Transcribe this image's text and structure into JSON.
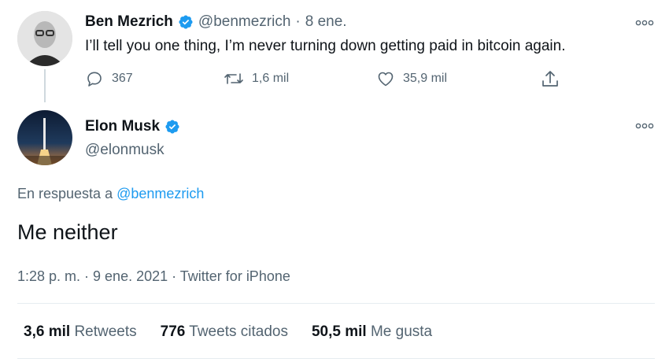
{
  "parent_tweet": {
    "author_name": "Ben Mezrich",
    "handle": "@benmezrich",
    "separator": "·",
    "date": "8 ene.",
    "text": "I’ll tell you one thing, I’m never turning down getting paid in bitcoin again.",
    "replies": "367",
    "retweets": "1,6 mil",
    "likes": "35,9 mil"
  },
  "main_tweet": {
    "author_name": "Elon Musk",
    "handle": "@elonmusk",
    "reply_prefix": "En respuesta a",
    "reply_to": "@benmezrich",
    "text": "Me neither",
    "timestamp": "1:28 p. m. · 9 ene. 2021 · Twitter for iPhone"
  },
  "stats": {
    "retweets_count": "3,6 mil",
    "retweets_label": "Retweets",
    "quotes_count": "776",
    "quotes_label": "Tweets citados",
    "likes_count": "50,5 mil",
    "likes_label": "Me gusta"
  },
  "colors": {
    "accent": "#1d9bf0",
    "text": "#0f1419",
    "muted": "#536471",
    "divider": "#e6ecf0"
  },
  "icons": [
    "verified-badge-icon",
    "more-options-icon",
    "reply-icon",
    "retweet-icon",
    "like-icon",
    "share-icon"
  ]
}
